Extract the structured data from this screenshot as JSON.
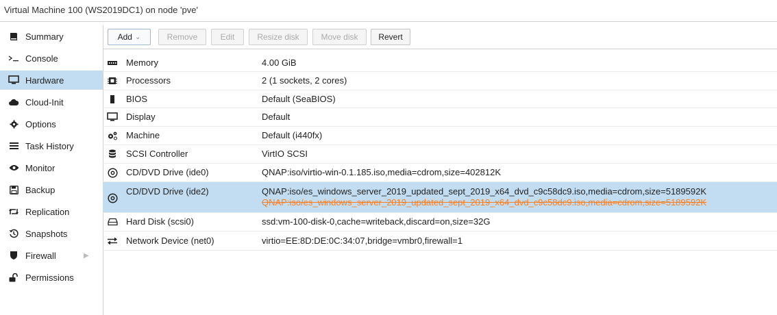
{
  "window": {
    "title": "Virtual Machine 100 (WS2019DC1) on node 'pve'"
  },
  "sidebar": {
    "items": [
      {
        "label": "Summary",
        "icon": "book-icon"
      },
      {
        "label": "Console",
        "icon": "terminal-icon"
      },
      {
        "label": "Hardware",
        "icon": "desktop-icon",
        "selected": true
      },
      {
        "label": "Cloud-Init",
        "icon": "cloud-icon"
      },
      {
        "label": "Options",
        "icon": "gear-icon"
      },
      {
        "label": "Task History",
        "icon": "list-icon"
      },
      {
        "label": "Monitor",
        "icon": "eye-icon"
      },
      {
        "label": "Backup",
        "icon": "floppy-icon"
      },
      {
        "label": "Replication",
        "icon": "retweet-icon"
      },
      {
        "label": "Snapshots",
        "icon": "history-icon"
      },
      {
        "label": "Firewall",
        "icon": "shield-icon"
      },
      {
        "label": "Permissions",
        "icon": "unlock-icon"
      }
    ]
  },
  "toolbar": {
    "add": "Add",
    "remove": "Remove",
    "edit": "Edit",
    "resize_disk": "Resize disk",
    "move_disk": "Move disk",
    "revert": "Revert"
  },
  "hardware": {
    "rows": [
      {
        "name": "Memory",
        "value": "4.00 GiB",
        "icon": "memory-icon"
      },
      {
        "name": "Processors",
        "value": "2 (1 sockets, 2 cores)",
        "icon": "cpu-icon"
      },
      {
        "name": "BIOS",
        "value": "Default (SeaBIOS)",
        "icon": "microchip-icon"
      },
      {
        "name": "Display",
        "value": "Default",
        "icon": "desktop-icon"
      },
      {
        "name": "Machine",
        "value": "Default (i440fx)",
        "icon": "cogs-icon"
      },
      {
        "name": "SCSI Controller",
        "value": "VirtIO SCSI",
        "icon": "database-icon"
      },
      {
        "name": "CD/DVD Drive (ide0)",
        "value": "QNAP:iso/virtio-win-0.1.185.iso,media=cdrom,size=402812K",
        "icon": "cdrom-icon"
      },
      {
        "name": "CD/DVD Drive (ide2)",
        "value": "QNAP:iso/es_windows_server_2019_updated_sept_2019_x64_dvd_c9c58dc9.iso,media=cdrom,size=5189592K",
        "pending": "QNAP:iso/es_windows_server_2019_updated_sept_2019_x64_dvd_c9c58dc9.iso,media=cdrom,size=5189592K",
        "icon": "cdrom-icon",
        "selected": true
      },
      {
        "name": "Hard Disk (scsi0)",
        "value": "ssd:vm-100-disk-0,cache=writeback,discard=on,size=32G",
        "icon": "hdd-icon"
      },
      {
        "name": "Network Device (net0)",
        "value": "virtio=EE:8D:DE:0C:34:07,bridge=vmbr0,firewall=1",
        "icon": "exchange-icon"
      }
    ]
  },
  "colors": {
    "selected_bg": "#c2ddf2",
    "pending_text": "#ff7f1e",
    "border": "#d0d0d0"
  }
}
